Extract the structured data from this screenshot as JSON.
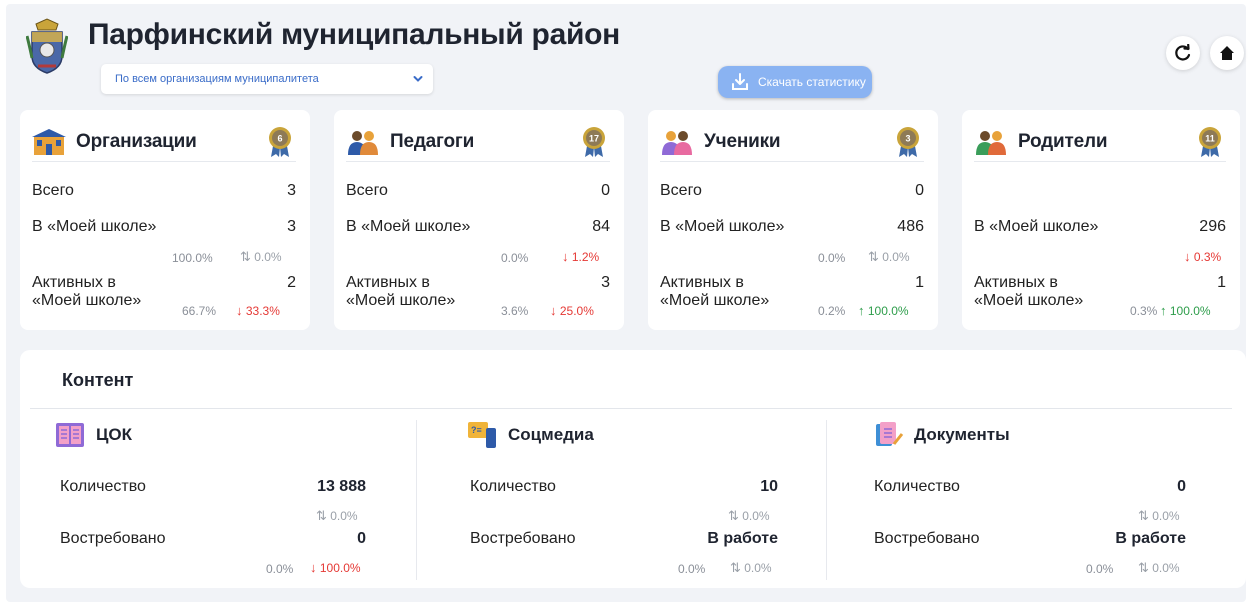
{
  "header": {
    "title": "Парфинский муниципальный район",
    "org_select": "По всем организациям муниципалитета",
    "download_label": "Скачать статистику"
  },
  "cards": [
    {
      "name": "Организации",
      "medal": "6",
      "total_label": "Всего",
      "total": "3",
      "school_label": "В «Моей школе»",
      "school": "3",
      "school_pct": "100.0%",
      "school_change": "0.0%",
      "active_label_1": "Активных в",
      "active_label_2": "«Моей школе»",
      "active": "2",
      "active_pct": "66.7%",
      "active_change": "33.3%"
    },
    {
      "name": "Педагоги",
      "medal": "17",
      "total_label": "Всего",
      "total": "0",
      "school_label": "В «Моей школе»",
      "school": "84",
      "school_pct": "0.0%",
      "school_change": "1.2%",
      "active_label_1": "Активных в",
      "active_label_2": "«Моей школе»",
      "active": "3",
      "active_pct": "3.6%",
      "active_change": "25.0%"
    },
    {
      "name": "Ученики",
      "medal": "3",
      "total_label": "Всего",
      "total": "0",
      "school_label": "В «Моей школе»",
      "school": "486",
      "school_pct": "0.0%",
      "school_change": "0.0%",
      "active_label_1": "Активных в",
      "active_label_2": "«Моей школе»",
      "active": "1",
      "active_pct": "0.2%",
      "active_change": "100.0%"
    },
    {
      "name": "Родители",
      "medal": "11",
      "school_label": "В «Моей школе»",
      "school": "296",
      "school_change": "0.3%",
      "active_label_1": "Активных в",
      "active_label_2": "«Моей школе»",
      "active": "1",
      "active_pct": "0.3%",
      "active_change": "100.0%"
    }
  ],
  "content": {
    "title": "Контент",
    "sections": [
      {
        "name": "ЦОК",
        "qty_label": "Количество",
        "qty": "13 888",
        "qty_change": "0.0%",
        "demand_label": "Востребовано",
        "demand": "0",
        "demand_pct": "0.0%",
        "demand_change": "100.0%"
      },
      {
        "name": "Соцмедиа",
        "qty_label": "Количество",
        "qty": "10",
        "qty_change": "0.0%",
        "demand_label": "Востребовано",
        "demand": "В работе",
        "demand_pct": "0.0%",
        "demand_change": "0.0%"
      },
      {
        "name": "Документы",
        "qty_label": "Количество",
        "qty": "0",
        "qty_change": "0.0%",
        "demand_label": "Востребовано",
        "demand": "В работе",
        "demand_pct": "0.0%",
        "demand_change": "0.0%"
      }
    ]
  },
  "icons": {
    "emblem": "coat-of-arms-icon",
    "refresh": "refresh-icon",
    "home": "home-icon",
    "download": "download-icon",
    "medal": "medal-icon",
    "arrow_down": "↓",
    "arrow_up": "↑",
    "arrows_flat": "⇅"
  },
  "colors": {
    "down": "#e53935",
    "up": "#2e9d4b",
    "flat": "#9aa0a8",
    "accent": "#8ab3f2",
    "link": "#3a6cc8"
  }
}
